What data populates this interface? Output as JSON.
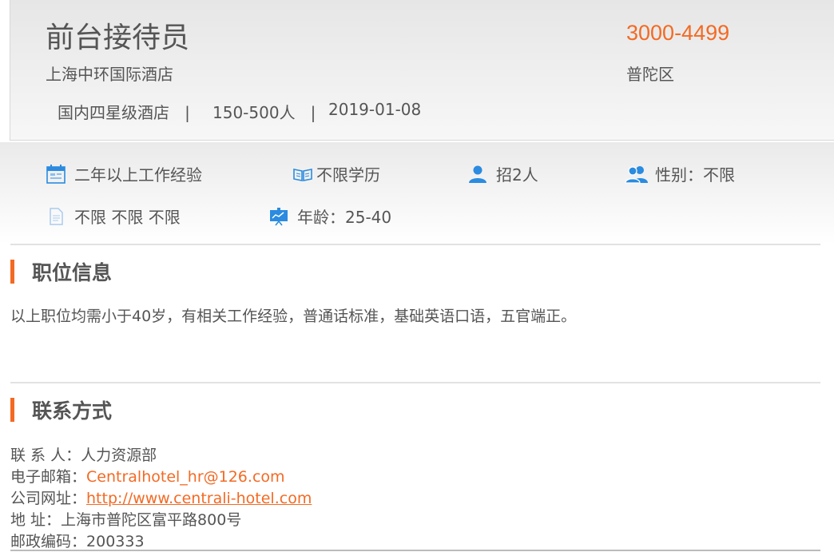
{
  "header": {
    "job_title": "前台接待员",
    "salary": "3000-4499",
    "company": "上海中环国际酒店",
    "district": "普陀区",
    "company_type": "国内四星级酒店",
    "company_size": "150-500人",
    "post_date": "2019-01-08",
    "separator": "|"
  },
  "requirements": {
    "experience": {
      "icon": "calendar-icon",
      "label": "二年以上工作经验"
    },
    "education": {
      "icon": "book-icon",
      "label": "不限学历"
    },
    "headcount": {
      "icon": "person-icon",
      "label": "招2人"
    },
    "gender": {
      "icon": "people-icon",
      "label": "性别：不限"
    },
    "other": {
      "icon": "document-icon",
      "label": "不限 不限 不限"
    },
    "age": {
      "icon": "presentation-icon",
      "label": "年龄：25-40"
    }
  },
  "job_info": {
    "title": "职位信息",
    "description": "以上职位均需小于40岁，有相关工作经验，普通话标准，基础英语口语，五官端正。"
  },
  "contact": {
    "title": "联系方式",
    "person_label": "联 系 人：",
    "person": "人力资源部",
    "email_label": "电子邮箱：",
    "email": "Centralhotel_hr@126.com",
    "website_label": "公司网址：",
    "website": "http://www.centrali-hotel.com",
    "address_label": "地 址：",
    "address": "上海市普陀区富平路800号",
    "postcode_label": "邮政编码：",
    "postcode": "200333"
  },
  "colors": {
    "accent": "#f36a24",
    "icon_blue": "#2a8be0",
    "text": "#555555"
  }
}
